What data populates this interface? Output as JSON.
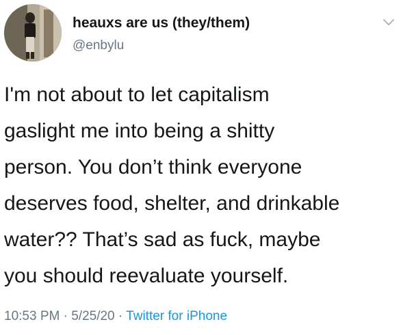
{
  "author": {
    "display_name": "heauxs are us (they/them)",
    "handle": "@enbylu",
    "avatar_icon": "profile-photo-avatar"
  },
  "header": {
    "menu_icon": "chevron-down-icon"
  },
  "tweet": {
    "lines": [
      "I'm not about to let capitalism",
      "gaslight me into being a shitty",
      "person. You don’t think everyone",
      "deserves food, shelter, and drinkable",
      "water?? That’s sad as fuck, maybe",
      "you should reevaluate yourself."
    ]
  },
  "meta": {
    "time": "10:53 PM",
    "separator": " · ",
    "date": "5/25/20",
    "source": "Twitter for iPhone"
  },
  "colors": {
    "text": "#14171a",
    "secondary": "#657786",
    "link": "#1b95e0"
  }
}
